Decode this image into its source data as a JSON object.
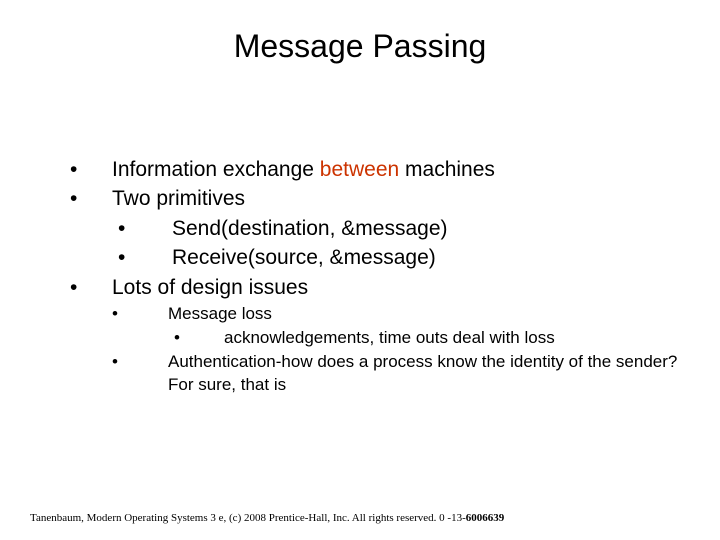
{
  "title": "Message Passing",
  "bullets": {
    "b1_pre": "Information exchange ",
    "b1_hl": "between",
    "b1_post": " machines",
    "b2": "Two primitives",
    "b2a": "Send(destination, &message)",
    "b2b": "Receive(source, &message)",
    "b3": "Lots of design issues",
    "b3a": "Message loss",
    "b3a1": "acknowledgements, time outs deal with loss",
    "b3b": "Authentication-how does a process know the identity of the sender? For sure, that is"
  },
  "footer": {
    "text": "Tanenbaum, Modern Operating Systems 3 e, (c) 2008 Prentice-Hall, Inc. All rights reserved. 0 -13-",
    "bold": "6006639"
  },
  "marks": {
    "dot": "•"
  }
}
